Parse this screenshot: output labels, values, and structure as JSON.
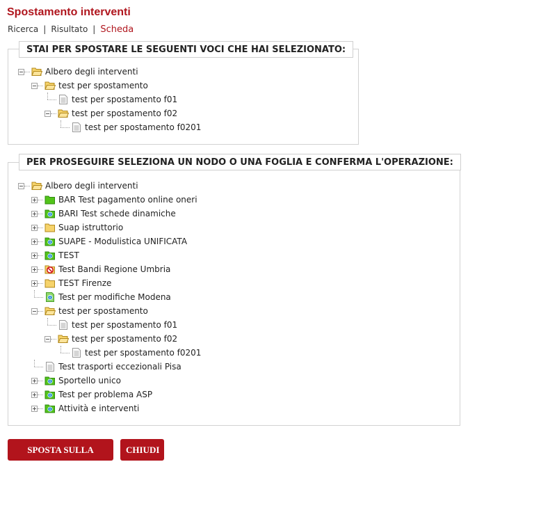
{
  "page": {
    "title": "Spostamento interventi"
  },
  "nav": [
    {
      "label": "Ricerca",
      "active": false
    },
    {
      "label": "Risultato",
      "active": false
    },
    {
      "label": "Scheda",
      "active": true
    }
  ],
  "nav_separator": "|",
  "selection": {
    "legend": "STAI PER SPOSTARE LE SEGUENTI VOCI CHE HAI SELEZIONATO:",
    "tree": [
      {
        "label": "Albero degli interventi",
        "icon": "folder-open-icon",
        "expanded": true
      },
      {
        "label": "test per spostamento",
        "icon": "folder-open-icon",
        "expanded": true
      },
      {
        "label": "test per spostamento f01",
        "icon": "document-icon"
      },
      {
        "label": "test per spostamento f02",
        "icon": "folder-open-icon",
        "expanded": true
      },
      {
        "label": "test per spostamento f0201",
        "icon": "document-icon"
      }
    ]
  },
  "destination": {
    "legend": "PER PROSEGUIRE SELEZIONA UN NODO O UNA FOGLIA E CONFERMA L'OPERAZIONE:",
    "tree": [
      {
        "label": "Albero degli interventi",
        "icon": "folder-open-icon",
        "expanded": true
      },
      {
        "label": "BAR Test pagamento online oneri",
        "icon": "green-folder-icon",
        "expanded": false
      },
      {
        "label": "BARI Test schede dinamiche",
        "icon": "green-info-folder-icon",
        "expanded": false
      },
      {
        "label": "Suap istruttorio",
        "icon": "yellow-folder-icon",
        "expanded": false
      },
      {
        "label": "SUAPE - Modulistica UNIFICATA",
        "icon": "green-info-folder-icon",
        "expanded": false
      },
      {
        "label": "TEST",
        "icon": "green-info-folder-icon",
        "expanded": false
      },
      {
        "label": "Test Bandi Regione Umbria",
        "icon": "forbidden-folder-icon",
        "expanded": false
      },
      {
        "label": "TEST Firenze",
        "icon": "yellow-folder-icon",
        "expanded": false
      },
      {
        "label": "Test per modifiche Modena",
        "icon": "green-info-document-icon"
      },
      {
        "label": "test per spostamento",
        "icon": "folder-open-icon",
        "expanded": true
      },
      {
        "label": "test per spostamento f01",
        "icon": "document-icon"
      },
      {
        "label": "test per spostamento f02",
        "icon": "folder-open-icon",
        "expanded": true
      },
      {
        "label": "test per spostamento f0201",
        "icon": "document-icon"
      },
      {
        "label": "Test trasporti eccezionali Pisa",
        "icon": "document-icon"
      },
      {
        "label": "Sportello unico",
        "icon": "green-info-folder-icon",
        "expanded": false
      },
      {
        "label": "Test per problema ASP",
        "icon": "green-info-folder-icon",
        "expanded": false
      },
      {
        "label": "Attività e interventi",
        "icon": "green-info-folder-icon",
        "expanded": false
      }
    ]
  },
  "buttons": {
    "move_root": "SPOSTA SULLA RADICE",
    "close": "CHIUDI"
  },
  "colors": {
    "accent": "#b0161e",
    "button": "#b2141c",
    "border": "#d2d2d2",
    "folder_yellow": "#f6d36b",
    "folder_green": "#52c41a"
  }
}
